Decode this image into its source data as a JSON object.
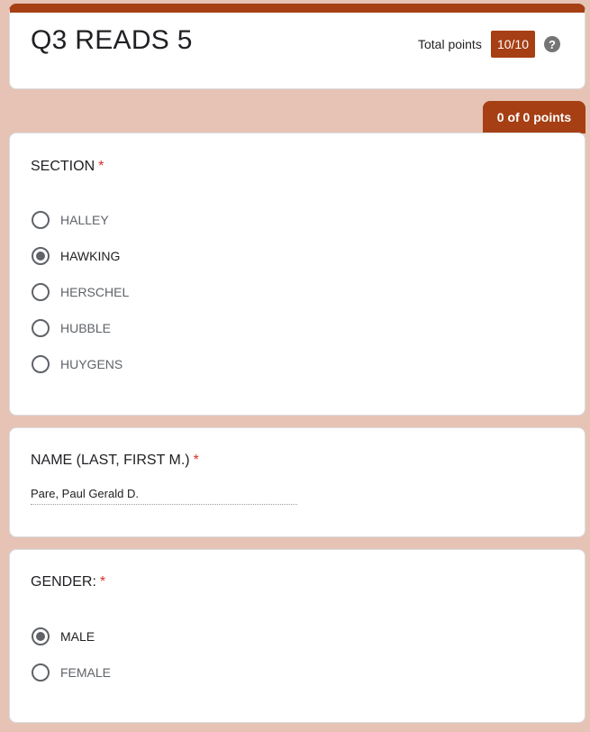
{
  "header": {
    "title": "Q3 READS 5",
    "total_points_label": "Total points",
    "total_points_value": "10/10",
    "help_icon": "?"
  },
  "points_tab": "0 of 0 points",
  "colors": {
    "accent": "#a63f14",
    "background": "#e6c3b5"
  },
  "questions": {
    "section": {
      "title": "SECTION",
      "required_mark": "*",
      "options": [
        {
          "label": "HALLEY",
          "selected": false
        },
        {
          "label": "HAWKING",
          "selected": true
        },
        {
          "label": "HERSCHEL",
          "selected": false
        },
        {
          "label": "HUBBLE",
          "selected": false
        },
        {
          "label": "HUYGENS",
          "selected": false
        }
      ]
    },
    "name": {
      "title": "NAME (LAST, FIRST M.)",
      "required_mark": "*",
      "answer": "Pare, Paul Gerald D."
    },
    "gender": {
      "title": "GENDER:",
      "required_mark": "*",
      "options": [
        {
          "label": "MALE",
          "selected": true
        },
        {
          "label": "FEMALE",
          "selected": false
        }
      ]
    }
  }
}
